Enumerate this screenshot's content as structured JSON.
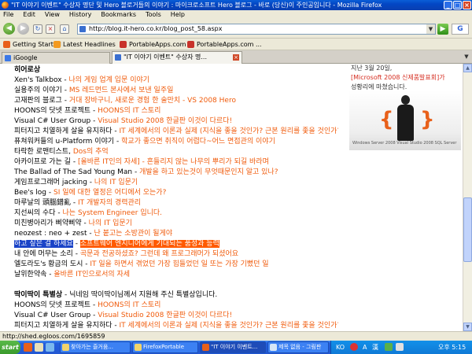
{
  "window": {
    "title": "\"IT 이야기 이벤트\" 수상자 명단 및 Hero 블로거들의 이야기 : 마이크로소프트 Hero 블로그 - 바로 (당신)이 주인공입니다 - Mozilla Firefox"
  },
  "menu": [
    "File",
    "Edit",
    "View",
    "History",
    "Bookmarks",
    "Tools",
    "Help"
  ],
  "address": {
    "url": "http://blog.it-hero.co.kr/blog_post_58.aspx"
  },
  "bookmarks": [
    "Getting Started",
    "Latest Headlines",
    "PortableApps.com",
    "PortableApps.com ..."
  ],
  "tabs": [
    {
      "label": "iGoogle",
      "active": false
    },
    {
      "label": "\"IT 이야기 이벤트\" 수상자 명...",
      "active": true
    }
  ],
  "content": {
    "section1_heading": "히어로상",
    "section1": [
      {
        "src": "Xen's Talkbox",
        "sep": " - ",
        "title": "나의 게임 업계 입문 이야기"
      },
      {
        "src": "실용주의 이야기",
        "sep": " - ",
        "title": "MS 레드먼드 본사에서 보낸 일주일"
      },
      {
        "src": "고재판의 블로그",
        "sep": " - ",
        "title": "거대 장바구니, 새로운 경험 한 술만치 - VS 2008 Hero"
      },
      {
        "src": "HOONS의 닷넷 프로젝트",
        "sep": " - ",
        "title": "HOONS의 IT 스토리"
      },
      {
        "src": "Visual C# User Group",
        "sep": " - ",
        "title": "Visual Studio 2008 한글판 이것이 다르다!"
      },
      {
        "src": "피터지고 치열하게 살을 유지하다",
        "sep": " - ",
        "title": "IT 세계에서의 이론과 실제 (지식을 좋을 것인가? 근본 원리를 좇을 것인가?)"
      },
      {
        "src": "퓨쳐워커들의 u-Platform 이야기",
        "sep": " - ",
        "title": "학교가 좋으면 취직이 어렵다~어느 면접관의 이야기"
      },
      {
        "src": "타락한 로맨티스트",
        "sep": ", ",
        "title": "Dos의 추억"
      },
      {
        "src": "아카이프로 가는 길",
        "sep": " - ",
        "title": "[올바른 IT인의 자세] - 흔들리지 않는 나무의 뿌리가 되길 바라며"
      },
      {
        "src": "The Ballad of The Sad Young Man",
        "sep": " - ",
        "title": "개발을 하고 있는것이 무엇때문인지 알고 있나?"
      },
      {
        "src": "게임프로그래머 jacking",
        "sep": " - ",
        "title": "나의 IT 입문기"
      },
      {
        "src": "Bee's log",
        "sep": " - ",
        "title": "SI 일에 대한 열정은 어디에서 오는가?"
      },
      {
        "src": "마루날의 頭腦錯亂",
        "sep": " - ",
        "title": "IT 개발자의 경력관리"
      },
      {
        "src": "지선씨의 수다",
        "sep": " - ",
        "title": "나는 System Engineer 입니다."
      },
      {
        "src": "미친병아리가 삐약삐약",
        "sep": " - ",
        "title": "나의 IT 입문기"
      },
      {
        "src": "neozest : neo + zest",
        "sep": " - ",
        "title": "난 붙고는 소방관이 될게야"
      },
      {
        "src": "하고 싶은 걸 하세요",
        "sep": " - ",
        "title": "소프트웨어 엔지니어에게 기대되는 품성과 능력",
        "highlight": true
      },
      {
        "src": "내 안에 머무는 소리",
        "sep": " - ",
        "title": "곡문과 전공하셨죠? 그런데 왜 프로그래머가 되셨어요"
      },
      {
        "src": "엘도라도's 황금의 도시",
        "sep": " - ",
        "title": "IT 일을 하면서 겪었던 가장 힘들었던 일 또는 가장 기뻤던 일"
      },
      {
        "src": "날위한약속",
        "sep": " - ",
        "title": "올바른 IT인으로서의 자세"
      }
    ],
    "section2_heading": "딱이딱이 특별상",
    "section2_desc": " - 닉네임 딱이딱이님께서 지원해 주신 특별상입니다.",
    "section2": [
      {
        "src": "HOONS의 닷넷 프로젝트",
        "sep": " - ",
        "title": "HOONS의 IT 스토리"
      },
      {
        "src": "Visual C# User Group",
        "sep": " - ",
        "title": "Visual Studio 2008 한글판 이것이 다르다!"
      },
      {
        "src": "피터지고 치열하게 살을 유지하다",
        "sep": " - ",
        "title": "IT 세계에서의 이론과 실제 (지식을 좋을 것인가? 근본 원리를 좇을 것인가?)"
      },
      {
        "src": "실용주의 이야기",
        "sep": " - ",
        "title": "MS 레드먼드 본사에서 보낸 일주일"
      },
      {
        "src": "날위한약속",
        "sep": " - ",
        "title": "올바른 IT인으로서의 자세"
      }
    ],
    "ad": {
      "line1": "지난 3월 20일,",
      "line2": "[Microsoft 2008 신제품발표회]가",
      "line3": "성황리에 마쳤습니다.",
      "logos": "Windows Server 2008  Visual Studio 2008  SQL Server"
    }
  },
  "statusbar": {
    "text": "http://shed.egloos.com/1695859"
  },
  "taskbar": {
    "start": "start",
    "tasks": [
      {
        "label": "찾아가는 즐거움...",
        "active": false
      },
      {
        "label": "FirefoxPortable",
        "active": false
      },
      {
        "label": "\"IT 이야기 이벤트...",
        "active": true
      },
      {
        "label": "제목 없음 - 그림판",
        "active": false
      }
    ],
    "tray": {
      "ime": "KO",
      "a": "A",
      "han": "漢",
      "clock": "오후 5:15"
    }
  },
  "colors": {
    "accent": "#f05a0a",
    "highlight_src": "#1a43c7",
    "highlight_title": "#ff5a00"
  }
}
